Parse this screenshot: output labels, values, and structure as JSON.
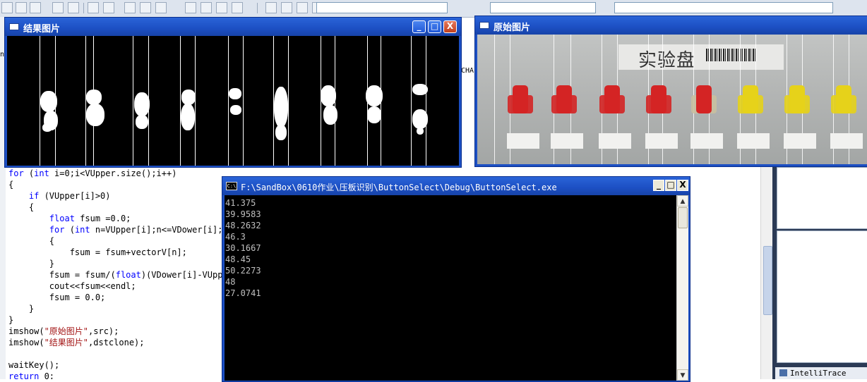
{
  "ide": {
    "intellitrace_label": "IntelliTrace",
    "side_fragment_n": "n",
    "side_fragment_char": "CHA",
    "code_lines": [
      "for (int i=0;i<VUpper.size();i++)",
      "{",
      "    if (VUpper[i]>0)",
      "    {",
      "        float fsum =0.0;",
      "        for (int n=VUpper[i];n<=VDower[i];n",
      "        {",
      "            fsum = fsum+vectorV[n];",
      "        }",
      "        fsum = fsum/(float)(VDower[i]-VUppe",
      "        cout<<fsum<<endl;",
      "        fsum = 0.0;",
      "    }",
      "}",
      "imshow(\"原始图片\",src);",
      "imshow(\"结果图片\",dstclone);",
      "",
      "waitKey();",
      "return 0;"
    ]
  },
  "result_window": {
    "title": "结果图片",
    "minimize_label": "_",
    "maximize_label": "□",
    "close_label": "X"
  },
  "original_window": {
    "title": "原始图片",
    "label_text": "实验盘"
  },
  "console_window": {
    "title": "F:\\SandBox\\0610作业\\压板识别\\ButtonSelect\\Debug\\ButtonSelect.exe",
    "icon_text": "C:\\",
    "minimize_label": "_",
    "maximize_label": "□",
    "close_label": "X",
    "output_lines": [
      "41.375",
      "39.9583",
      "48.2632",
      "46.3",
      "30.1667",
      "48.45",
      "50.2273",
      "48",
      "27.0741"
    ],
    "scroll_up": "▲",
    "scroll_down": "▼"
  },
  "colors": {
    "title_bar": "#1c4fc3",
    "console_title": "#1c4fc3",
    "button_red": "#d42424",
    "button_yellow": "#e6d21a"
  }
}
